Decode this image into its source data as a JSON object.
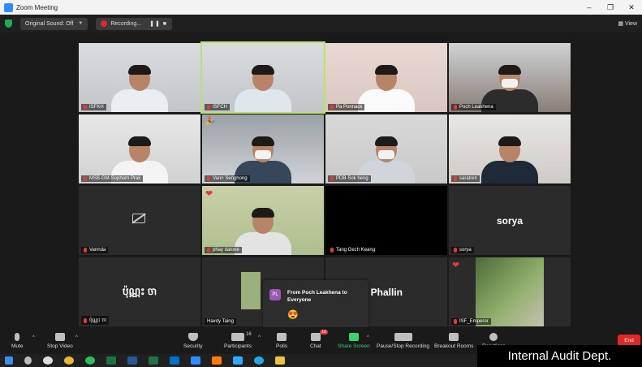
{
  "window": {
    "title": "Zoom Meeting",
    "controls": [
      "–",
      "❐",
      "✕"
    ]
  },
  "meetbar": {
    "original_sound": "Original Sound: Off",
    "recording": "Recording...",
    "rec_controls": "❚❚ ■",
    "view_label": "View"
  },
  "tiles": [
    {
      "name": "ISFKH",
      "kind": "video"
    },
    {
      "name": "ISFCH",
      "kind": "video",
      "active": true
    },
    {
      "name": "Pa Ponnack",
      "kind": "video"
    },
    {
      "name": "Poch Leakhena",
      "kind": "video"
    },
    {
      "name": "MSB-GM-Sophorn Prak",
      "kind": "video"
    },
    {
      "name": "Vann Senghong",
      "kind": "video"
    },
    {
      "name": "PDB-Sok heng",
      "kind": "video"
    },
    {
      "name": "saratren",
      "kind": "video"
    },
    {
      "name": "Vannda",
      "kind": "camoff"
    },
    {
      "name": "phay dalone",
      "kind": "video"
    },
    {
      "name": "Tang Gech Keang",
      "kind": "black"
    },
    {
      "name": "sorya",
      "kind": "text",
      "big": "sorya"
    },
    {
      "name": "ប៉ុណ្ណះ ចា",
      "kind": "text",
      "big": "ប៉ុណ្ណះ ចា"
    },
    {
      "name": "Havdy Taing",
      "kind": "thumb"
    },
    {
      "name": "",
      "kind": "text",
      "big": "Phallin"
    },
    {
      "name": "ISF_Emperor",
      "kind": "video"
    }
  ],
  "chat_popup": {
    "avatar": "PL",
    "from": "From Poch Leakhena to Everyone",
    "emoji": "😍"
  },
  "toolbar": {
    "mute": "Mute",
    "stop_video": "Stop Video",
    "security": "Security",
    "participants": "Participants",
    "participants_count": "16",
    "polls": "Polls",
    "chat": "Chat",
    "chat_badge": "16",
    "share_screen": "Share Screen",
    "pause_recording": "Pause/Stop Recording",
    "breakout_rooms": "Breakout Rooms",
    "reactions": "Reactions",
    "end": "End"
  },
  "watermark": "Internal Audit Dept.",
  "colors": {
    "active_speaker": "#b7e36b",
    "share_green": "#3bd16f",
    "end_red": "#e02828"
  }
}
